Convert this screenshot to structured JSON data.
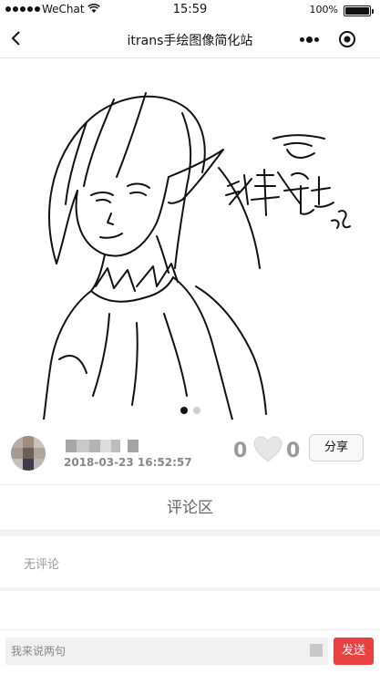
{
  "statusbar": {
    "carrier": "WeChat",
    "time": "15:59",
    "battery": "100%",
    "battery_level": 1.0
  },
  "navbar": {
    "title": "itrans手绘图像简化站",
    "back_icon": "chevron-left-icon",
    "more_icon": "more-dots-icon",
    "close_icon": "target-circle-icon"
  },
  "gallery": {
    "image_caption": "洋芋骑士 95",
    "slide_count": 2,
    "active_slide": 1
  },
  "post": {
    "username": "",
    "timestamp": "2018-03-23 16:52:57",
    "like_count": "0",
    "fav_count": "0",
    "share_label": "分享",
    "heart_icon": "heart-icon"
  },
  "comments": {
    "title": "评论区",
    "empty_text": "无评论"
  },
  "input": {
    "placeholder": "我来说两句",
    "send_label": "发送"
  },
  "colors": {
    "accent": "#e64340",
    "muted_number": "#9a9a9a"
  }
}
